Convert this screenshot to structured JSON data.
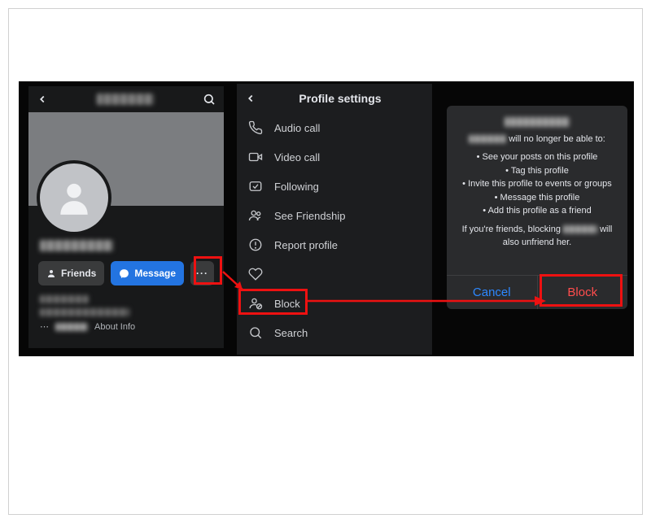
{
  "panel1": {
    "friends_label": "Friends",
    "message_label": "Message",
    "more_label": "···",
    "about_info": "About Info"
  },
  "panel2": {
    "title": "Profile settings",
    "items": [
      {
        "label": "Audio call"
      },
      {
        "label": "Video call"
      },
      {
        "label": "Following"
      },
      {
        "label": "See Friendship"
      },
      {
        "label": "Report profile"
      },
      {
        "label": ""
      },
      {
        "label": "Block"
      },
      {
        "label": "Search"
      }
    ]
  },
  "panel3": {
    "line1_suffix": " will no longer be able to:",
    "bullets": [
      "See your posts on this profile",
      "Tag this profile",
      "Invite this profile to events or groups",
      "Message this profile",
      "Add this profile as a friend"
    ],
    "line2_prefix": "If you're friends, blocking ",
    "line2_suffix": " will also unfriend her.",
    "cancel_label": "Cancel",
    "block_label": "Block"
  }
}
